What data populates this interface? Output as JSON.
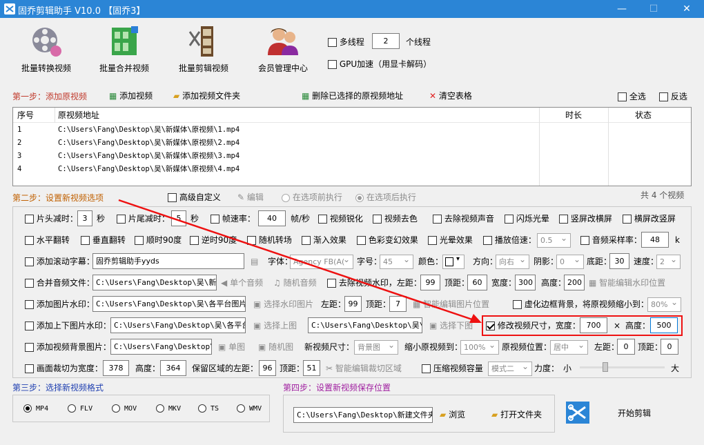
{
  "window": {
    "title": "固乔剪辑助手 V10.0 【固乔3】",
    "min": "—",
    "max": "☐",
    "close": "✕"
  },
  "toolbar": [
    {
      "label": "批量转换视频",
      "icon": "film-reel-icon"
    },
    {
      "label": "批量合并视频",
      "icon": "merge-grid-icon"
    },
    {
      "label": "批量剪辑视频",
      "icon": "film-strip-icon"
    },
    {
      "label": "会员管理中心",
      "icon": "users-icon"
    }
  ],
  "threads": {
    "multi_label": "多线程",
    "count": "2",
    "unit": "个线程",
    "gpu_label": "GPU加速（用显卡解码）"
  },
  "step1": {
    "title": "第一步：添加原视频",
    "add_video": "添加视频",
    "add_folder": "添加视频文件夹",
    "delete_selected": "删除已选择的原视频地址",
    "clear_table": "清空表格",
    "select_all": "全选",
    "invert": "反选"
  },
  "table": {
    "columns": [
      "序号",
      "原视频地址",
      "时长",
      "状态"
    ],
    "rows": [
      {
        "no": "1",
        "path": "C:\\Users\\Fang\\Desktop\\吴\\新媒体\\原视频\\1.mp4"
      },
      {
        "no": "2",
        "path": "C:\\Users\\Fang\\Desktop\\吴\\新媒体\\原视频\\2.mp4"
      },
      {
        "no": "3",
        "path": "C:\\Users\\Fang\\Desktop\\吴\\新媒体\\原视频\\3.mp4"
      },
      {
        "no": "4",
        "path": "C:\\Users\\Fang\\Desktop\\吴\\新媒体\\原视频\\4.mp4"
      }
    ],
    "total": "共 4 个视频"
  },
  "step2": {
    "title": "第二步：设置新视频选项",
    "advanced": "高级自定义",
    "edit": "编辑",
    "before": "在选项前执行",
    "after": "在选项后执行"
  },
  "r1": {
    "head_cut": "片头减时：",
    "head_val": "3",
    "sec": "秒",
    "tail_cut": "片尾减时：",
    "tail_val": "5",
    "sec2": "秒",
    "fps": "帧速率：",
    "fps_val": "40",
    "fps_unit": "帧/秒",
    "sharpen": "视频锐化",
    "decolor": "视频去色",
    "remove_audio": "去除视频声音",
    "flash": "闪烁光晕",
    "v2h": "竖屏改横屏",
    "h2v": "横屏改竖屏"
  },
  "r2": {
    "hflip": "水平翻转",
    "vflip": "垂直翻转",
    "cw90": "顺时90度",
    "ccw90": "逆时90度",
    "random_transition": "随机转场",
    "fade_in": "渐入效果",
    "color_flicker": "色彩变幻效果",
    "glow": "光晕效果",
    "speed": "播放倍速：",
    "speed_val": "0.5",
    "sample_rate": "音频采样率：",
    "sample_val": "48",
    "k": "k"
  },
  "r3": {
    "subtitle": "添加滚动字幕：",
    "subtitle_val": "固乔剪辑助手yyds",
    "font": "字体：",
    "font_val": "Agency FB(A(",
    "size": "字号：",
    "size_val": "45",
    "color": "颜色：",
    "direction": "方向：",
    "direction_val": "向右",
    "shadow": "阴影：",
    "shadow_val": "0",
    "bottom": "底距：",
    "bottom_val": "30",
    "speed": "速度：",
    "speed_val": "2"
  },
  "r4": {
    "merge_audio": "合并音频文件：",
    "merge_path": "C:\\Users\\Fang\\Desktop\\吴\\新媒体",
    "single_audio": "单个音频",
    "random_audio": "随机音频",
    "remove_watermark": "去除视频水印，左距：",
    "left_val": "99",
    "top": "顶距：",
    "top_val": "60",
    "width": "宽度：",
    "width_val": "300",
    "height": "高度：",
    "height_val": "200",
    "smart": "智能编辑水印位置"
  },
  "r5": {
    "image_watermark": "添加图片水印：",
    "image_path": "C:\\Users\\Fang\\Desktop\\吴\\各平台图片及",
    "choose": "选择水印图片",
    "left": "左距：",
    "left_val": "99",
    "top": "顶距：",
    "top_val": "7",
    "smart": "智能编辑图片位置",
    "blur": "虚化边框背景，将原视频缩小到：",
    "blur_val": "80%"
  },
  "r6": {
    "updown": "添加上下图片水印：",
    "path1": "C:\\Users\\Fang\\Desktop\\吴\\各平台图",
    "choose_up": "选择上图",
    "path2": "C:\\Users\\Fang\\Desktop\\吴\\各",
    "choose_down": "选择下图",
    "resize": "修改视频尺寸，宽度：",
    "width_val": "700",
    "x": "×",
    "height": "高度：",
    "height_val": "500"
  },
  "r7": {
    "bg_image": "添加视频背景图片：",
    "bg_path": "C:\\Users\\Fang\\Desktop\\吴",
    "single": "单图",
    "random": "随机图",
    "new_size": "新视频尺寸：",
    "new_size_val": "背景图",
    "shrink": "缩小原视频到：",
    "shrink_val": "100%",
    "position": "原视频位置：",
    "position_val": "居中",
    "left": "左距：",
    "left_val": "0",
    "top": "顶距：",
    "top_val": "0"
  },
  "r8": {
    "crop": "画面裁切为宽度：",
    "crop_w": "378",
    "height": "高度：",
    "crop_h": "364",
    "keep_left": "保留区域的左距：",
    "keep_left_val": "96",
    "top": "顶距：",
    "top_val": "51",
    "smart_crop": "智能编辑裁切区域",
    "compress": "压缩视频容量",
    "mode": "模式二",
    "strength": "力度：",
    "small": "小",
    "large": "大",
    "strength_level": 0.3
  },
  "step3": {
    "title": "第三步：选择新视频格式",
    "formats": [
      "MP4",
      "FLV",
      "MOV",
      "MKV",
      "TS",
      "WMV"
    ]
  },
  "step4": {
    "title": "第四步：设置新视频保存位置",
    "path": "C:\\Users\\Fang\\Desktop\\新建文件夹",
    "browse": "浏览",
    "open": "打开文件夹",
    "start": "开始剪辑"
  },
  "colors": {
    "titlebar": "#2b85d6",
    "highlight": "#e11111",
    "step_red": "#c0392b",
    "step_blue": "#1f3fb0",
    "step_purple": "#a020a0"
  }
}
